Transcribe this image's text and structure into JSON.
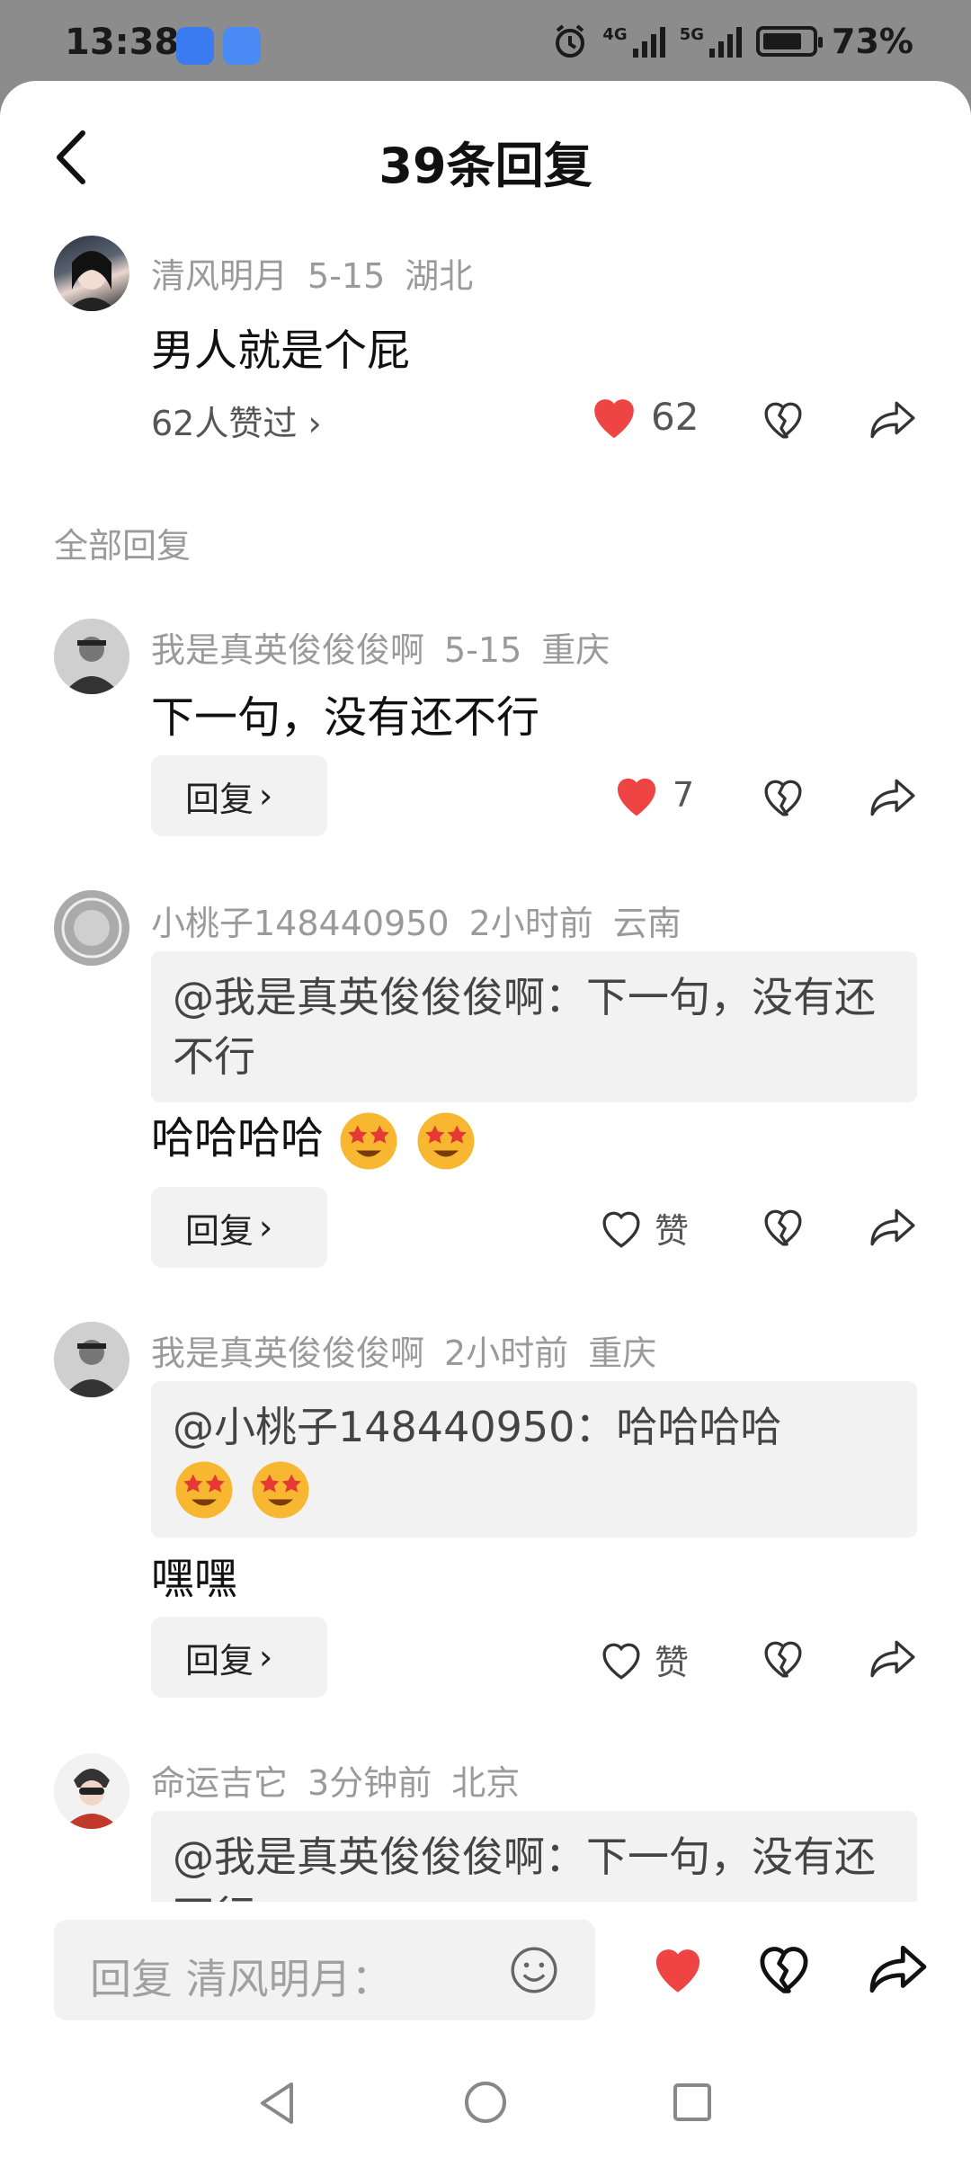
{
  "status_bar": {
    "time": "13:38",
    "net1": "4G",
    "net2": "5G",
    "battery": "73%"
  },
  "header": {
    "title": "39条回复"
  },
  "main_comment": {
    "user": "清风明月",
    "date": "5-15",
    "location": "湖北",
    "text": "男人就是个屁",
    "likers": "62人赞过",
    "likes": "62"
  },
  "section_label": "全部回复",
  "replies": [
    {
      "user": "我是真英俊俊俊啊",
      "time": "5-15",
      "location": "重庆",
      "text": "下一句，没有还不行",
      "reply_label": "回复",
      "like_count": "7"
    },
    {
      "user": "小桃子148440950",
      "time": "2小时前",
      "location": "云南",
      "quote": "@我是真英俊俊俊啊：下一句，没有还不行",
      "text": "哈哈哈哈",
      "reply_label": "回复",
      "like_label": "赞"
    },
    {
      "user": "我是真英俊俊俊啊",
      "time": "2小时前",
      "location": "重庆",
      "quote": "@小桃子148440950：哈哈哈哈",
      "text": "嘿嘿",
      "reply_label": "回复",
      "like_label": "赞"
    },
    {
      "user": "命运吉它",
      "time": "3分钟前",
      "location": "北京",
      "quote": "@我是真英俊俊俊啊：下一句，没有还不行"
    }
  ],
  "input": {
    "placeholder": "回复 清风明月："
  },
  "colors": {
    "accent_red": "#ef4444",
    "muted": "#9a9a9a",
    "panel": "#f2f2f2"
  },
  "icons": [
    "back-icon",
    "heart-icon",
    "broken-heart-icon",
    "share-icon",
    "smile-icon",
    "nav-back-icon",
    "nav-home-icon",
    "nav-recents-icon"
  ]
}
